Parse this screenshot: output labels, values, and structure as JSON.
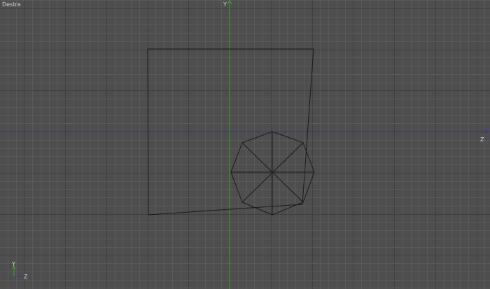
{
  "viewport": {
    "name": "Destra",
    "axis_labels": {
      "vertical": "Y",
      "horizontal": "Z"
    },
    "gizmo_labels": {
      "up": "Y",
      "right": "Z"
    }
  },
  "colors": {
    "background": "#4e4e4e",
    "grid_minor": "#5a5a5a",
    "grid_major": "#3f3f3f",
    "vertical_axis": "#4aa02c",
    "horizontal_axis": "#3a3a8c",
    "wire": "#1a1a1a",
    "label": "#d6d6d6"
  }
}
